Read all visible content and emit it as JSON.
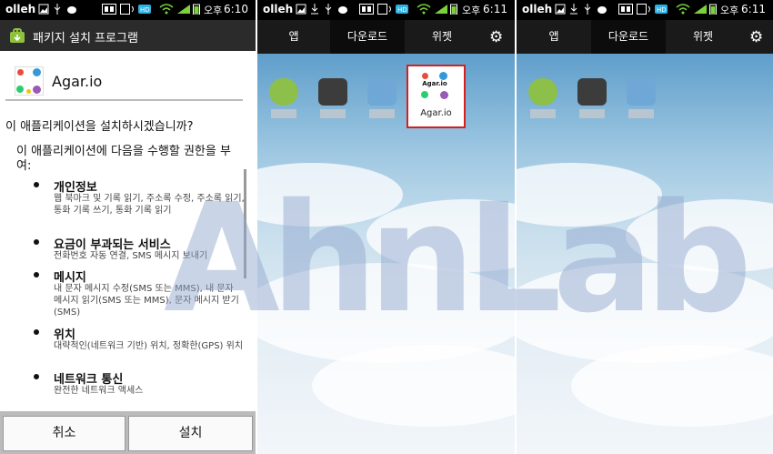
{
  "status": {
    "carrier": "olleh",
    "ampm": "오후",
    "times": [
      "6:10",
      "6:11",
      "6:11"
    ]
  },
  "installer": {
    "title": "패키지 설치 프로그램",
    "app_name": "Agar.io",
    "question": "이 애플리케이션을 설치하시겠습니까?",
    "intro": "이 애플리케이션에 다음을 수행할 권한을 부여:",
    "permissions": [
      {
        "title": "개인정보",
        "desc": "웹 북마크 및 기록 읽기, 주소록 수정, 주소록 읽기, 통화 기록 쓰기, 통화 기록 읽기"
      },
      {
        "title": "요금이 부과되는 서비스",
        "desc": "전화번호 자동 연결, SMS 메시지 보내기"
      },
      {
        "title": "메시지",
        "desc": "내 문자 메시지 수정(SMS 또는 MMS), 내 문자 메시지 읽기(SMS 또는 MMS), 문자 메시지 받기(SMS)"
      },
      {
        "title": "위치",
        "desc": "대략적인(네트워크 기반) 위치, 정확한(GPS) 위치"
      },
      {
        "title": "네트워크 통신",
        "desc": "완전한 네트워크 액세스"
      }
    ],
    "cancel_label": "취소",
    "install_label": "설치"
  },
  "drawer": {
    "tabs": [
      "앱",
      "다운로드",
      "위젯"
    ],
    "selected_tab": "다운로드",
    "highlight_label": "Agar.io"
  },
  "icon_text": "Agar.io",
  "watermark": "AhnLab",
  "colors": {
    "tab_indicator": "#2f8fd8",
    "highlight_border": "#d42020"
  }
}
